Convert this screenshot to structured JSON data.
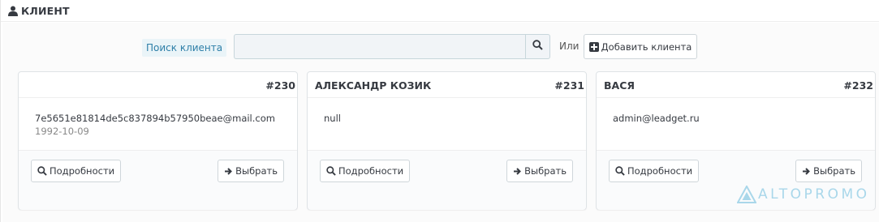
{
  "header": {
    "title": "КЛИЕНТ",
    "icon": "user-icon"
  },
  "search": {
    "label": "Поиск клиента",
    "value": "",
    "placeholder": "",
    "or_text": "Или",
    "add_label": "Добавить клиента"
  },
  "cards": [
    {
      "name": "",
      "id": "#230",
      "email": "7e5651e81814de5c837894b57950beae@mail.com",
      "dob": "1992-10-09",
      "details_label": "Подробности",
      "select_label": "Выбрать"
    },
    {
      "name": "АЛЕКСАНДР КОЗИК",
      "id": "#231",
      "email": "null",
      "dob": "",
      "details_label": "Подробности",
      "select_label": "Выбрать"
    },
    {
      "name": "ВАСЯ",
      "id": "#232",
      "email": "admin@leadget.ru",
      "dob": "",
      "details_label": "Подробности",
      "select_label": "Выбрать"
    }
  ],
  "watermark": {
    "text": "ALTOPROMO",
    "color": "#a9d7ea"
  },
  "colors": {
    "accent": "#2e7fa8",
    "label_bg": "#eaf4f8",
    "text_dark": "#363a41"
  }
}
